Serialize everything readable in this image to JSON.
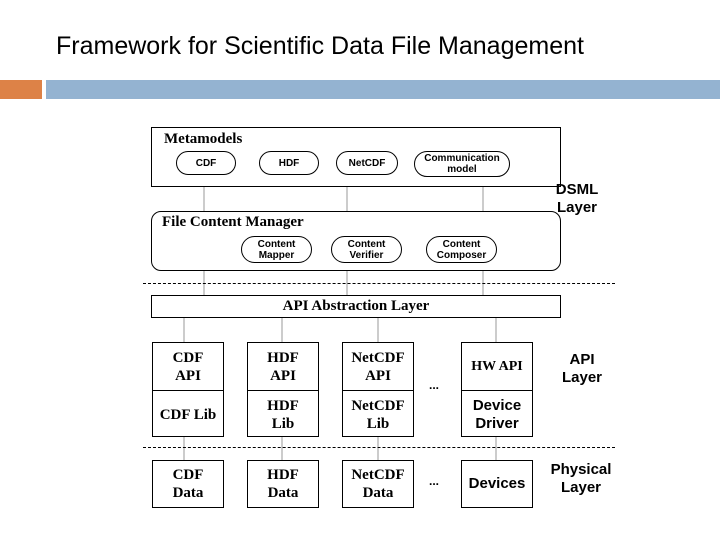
{
  "slide": {
    "title": "Framework for Scientific Data File Management",
    "accent_colors": {
      "orange": "#dd8247",
      "blue": "#94b3d1"
    }
  },
  "diagram": {
    "metamodels": {
      "title": "Metamodels",
      "items": [
        "CDF",
        "HDF",
        "NetCDF",
        "Communication model"
      ]
    },
    "file_content_manager": {
      "title": "File Content Manager",
      "items": [
        "Content Mapper",
        "Content Verifier",
        "Content Composer"
      ]
    },
    "api_abstraction_layer": {
      "title": "API Abstraction Layer"
    },
    "api_stacks": [
      {
        "api": "CDF API",
        "lib": "CDF Lib"
      },
      {
        "api": "HDF API",
        "lib": "HDF Lib"
      },
      {
        "api": "NetCDF API",
        "lib": "NetCDF Lib"
      },
      {
        "api": "HW API",
        "lib": "Device Driver"
      }
    ],
    "physical_items": [
      "CDF Data",
      "HDF Data",
      "NetCDF Data",
      "Devices"
    ],
    "ellipsis": "...",
    "layer_labels": {
      "dsml": "DSML Layer",
      "api": "API Layer",
      "physical": "Physical Layer"
    }
  }
}
